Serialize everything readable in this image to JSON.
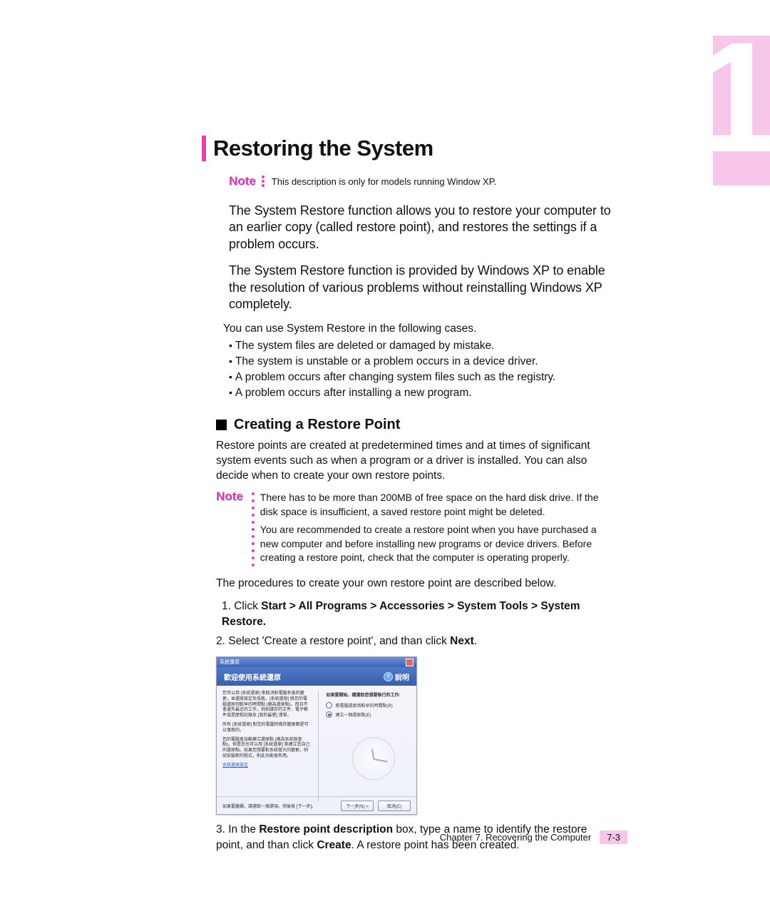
{
  "chapter_tab": {
    "number": "1"
  },
  "title": "Restoring the System",
  "note_label": "Note",
  "note_intro": "This description is only for models running Window XP.",
  "body": {
    "p1": "The System Restore function allows you to restore your computer to an earlier copy (called restore point), and restores the settings if a problem occurs.",
    "p2": "The System Restore function is provided by Windows XP to enable the resolution of various problems without reinstalling Windows XP completely.",
    "cases_intro": "You can use System Restore in the following cases.",
    "cases": [
      "The system files are deleted or damaged by mistake.",
      "The system is unstable or a problem occurs in a device driver.",
      "A problem occurs after changing system files such as the registry.",
      "A problem occurs after installing a new program."
    ]
  },
  "section": {
    "heading": "Creating a Restore Point",
    "para": "Restore points are created at predetermined times and at times of significant system events such as when a program or a driver is installed. You can also decide when to create your own restore points.",
    "note_p1": "There has to be more than 200MB of free space on the hard disk drive. If the disk space is insufficient, a saved restore point might be deleted.",
    "note_p2": "You are recommended to create a restore point when you have purchased a new computer and before installing new programs or device drivers. Before creating a restore point, check that the computer is operating properly.",
    "proc_intro": "The procedures to create your own restore point are described below.",
    "step1_pre": "1. Click ",
    "step1_bold": "Start > All Programs > Accessories > System Tools > System Restore.",
    "step2_pre": "2. Select 'Create a restore point', and than click ",
    "step2_bold": "Next",
    "step2_post": ".",
    "step3_pre": "3. In the ",
    "step3_bold1": "Restore point description",
    "step3_mid": " box, type a name to identify the restore point, and than click ",
    "step3_bold2": "Create",
    "step3_post": ". A restore point has been created."
  },
  "screenshot": {
    "titlebar_left": "系統還原",
    "band_title": "歡迎使用系統還原",
    "help_label": "說明",
    "left_lines": [
      "您可以用 [系統還原] 來取消對電腦有害的變更，並還原設定及效能。[系統還原] 將您的電腦還原到較早的時間點 (稱為還原點)，而且不會遺失最近的工作，例如儲存的文件、電子郵件或是歷程記錄及 [我的最愛] 清單。",
      "所有 [系統還原] 對您的電腦所做的變更都是可以復原的。",
      "您的電腦會自動建立還原點 (稱為系統檢查點)，但是您也可以用 [系統還原] 來建立您自己的還原點。如果您想要對系統做大的變更，例如安裝新的程式，則此功能很有用。",
      "系統還原設定"
    ],
    "right_label": "如果要開始，請選取您想要執行的工作:",
    "radio1": "將電腦還原到較早的時間點(R)",
    "radio2": "建立一個還原點(E)",
    "footer_hint": "如果要繼續，請選取一個選項，然後按 [下一步]。",
    "btn_next": "下一步(N) >",
    "btn_cancel": "取消(C)"
  },
  "footer": {
    "chapter": "Chapter 7. Recovering the Computer",
    "page": "7-3"
  }
}
